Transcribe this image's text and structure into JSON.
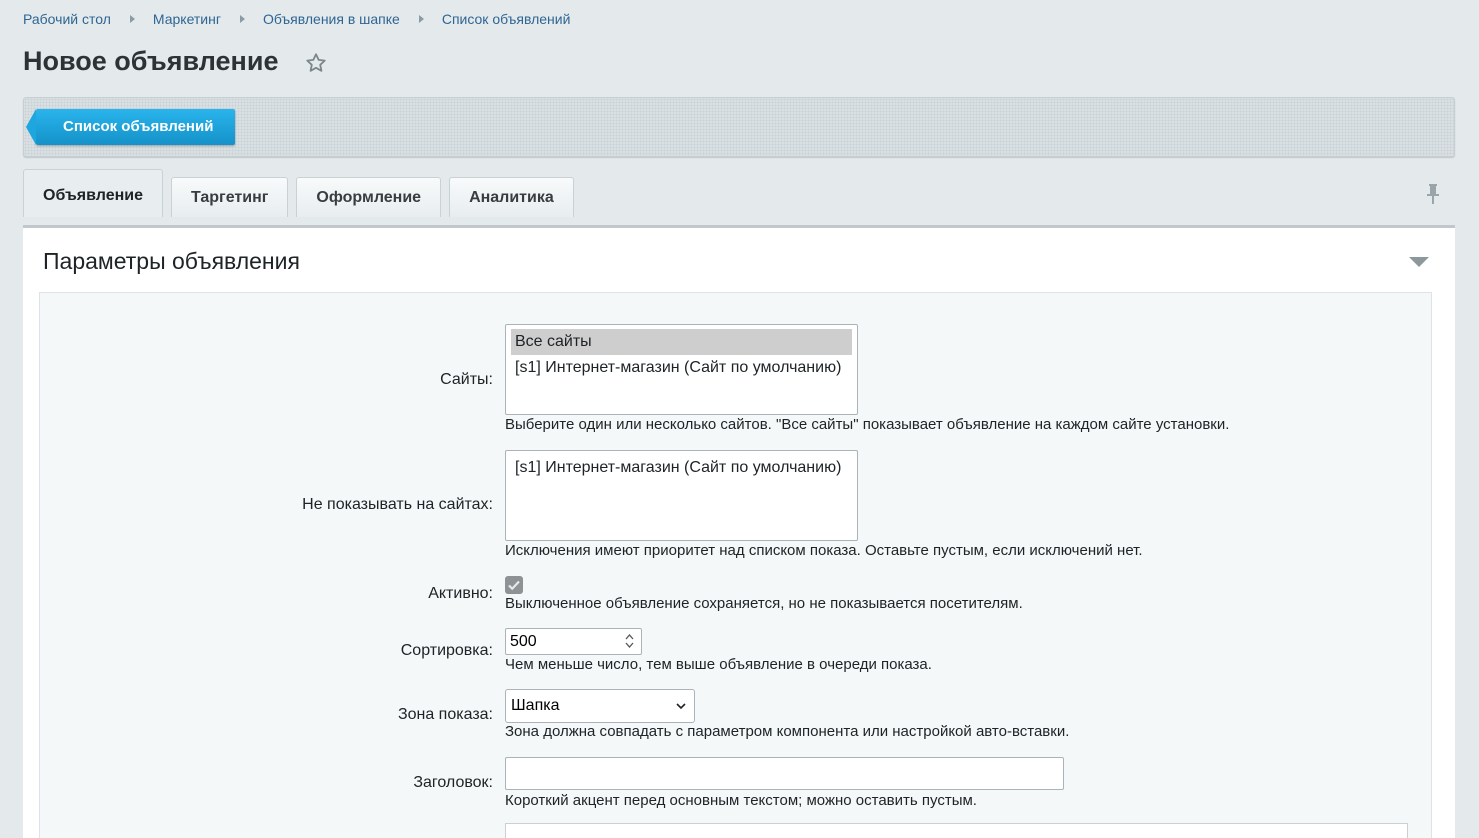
{
  "breadcrumb": [
    "Рабочий стол",
    "Маркетинг",
    "Объявления в шапке",
    "Список объявлений"
  ],
  "page_title": "Новое объявление",
  "toolbar": {
    "back_label": "Список объявлений"
  },
  "tabs": [
    "Объявление",
    "Таргетинг",
    "Оформление",
    "Аналитика"
  ],
  "active_tab": "Объявление",
  "section_title": "Параметры объявления",
  "form": {
    "sites": {
      "label": "Сайты:",
      "options": [
        "Все сайты",
        "[s1] Интернет-магазин (Сайт по умолчанию)"
      ],
      "hint": "Выберите один или несколько сайтов. \"Все сайты\" показывает объявление на каждом сайте установки."
    },
    "exclude_sites": {
      "label": "Не показывать на сайтах:",
      "options": [
        "[s1] Интернет-магазин (Сайт по умолчанию)"
      ],
      "hint": "Исключения имеют приоритет над списком показа. Оставьте пустым, если исключений нет."
    },
    "active": {
      "label": "Активно:",
      "checked": true,
      "hint": "Выключенное объявление сохраняется, но не показывается посетителям."
    },
    "sort": {
      "label": "Сортировка:",
      "value": "500",
      "hint": "Чем меньше число, тем выше объявление в очереди показа."
    },
    "zone": {
      "label": "Зона показа:",
      "value": "Шапка",
      "hint": "Зона должна совпадать с параметром компонента или настройкой авто-вставки."
    },
    "heading": {
      "label": "Заголовок:",
      "value": "",
      "hint": "Короткий акцент перед основным текстом; можно оставить пустым."
    }
  },
  "colors": {
    "accent": "#1ea6de",
    "link": "#2f6593",
    "background": "#e4eaec"
  }
}
